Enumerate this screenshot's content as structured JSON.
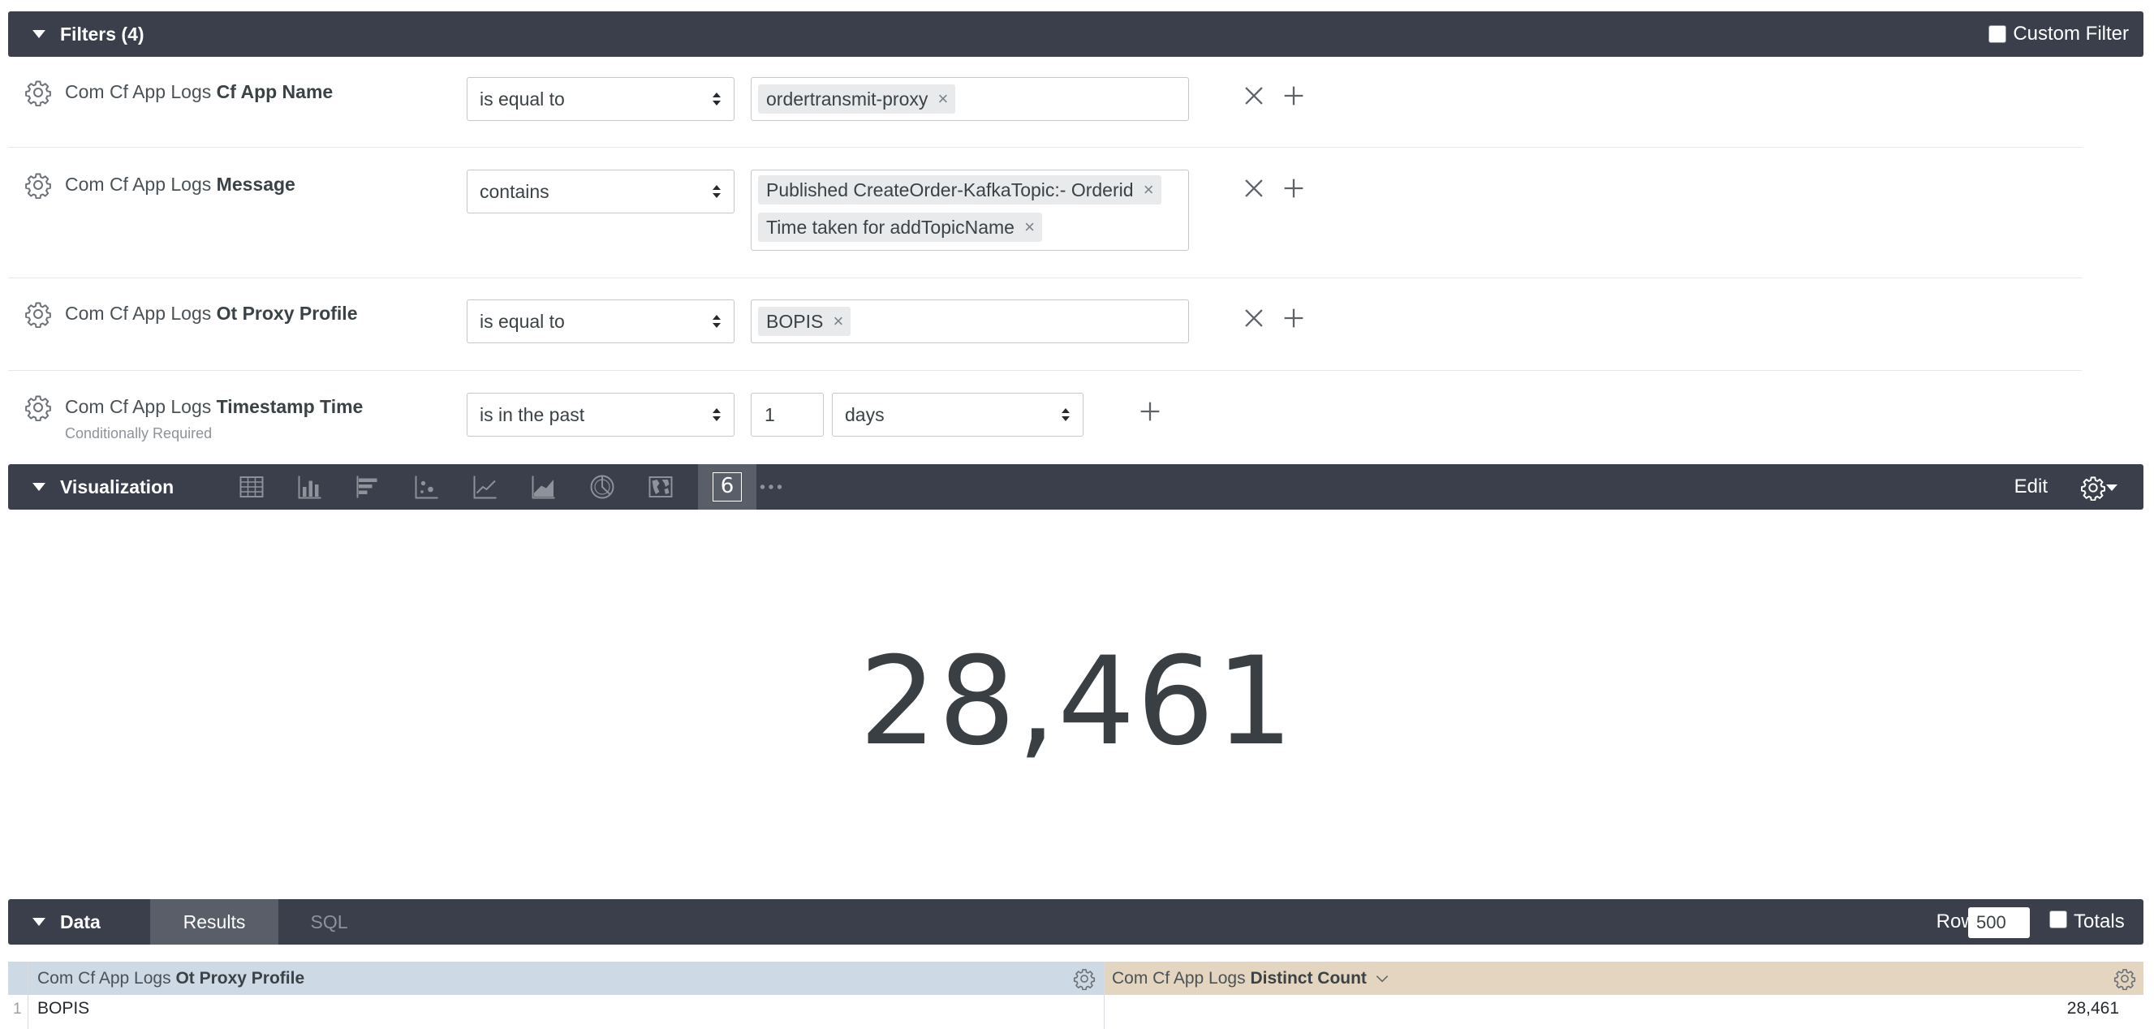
{
  "filters": {
    "title": "Filters (4)",
    "custom_filter_label": "Custom Filter",
    "rows": [
      {
        "label_prefix": "Com Cf App Logs",
        "label_field": "Cf App Name",
        "operator": "is equal to",
        "values": [
          "ordertransmit-proxy"
        ]
      },
      {
        "label_prefix": "Com Cf App Logs",
        "label_field": "Message",
        "operator": "contains",
        "values": [
          "Published CreateOrder-KafkaTopic:- Orderid",
          "Time taken for addTopicName"
        ]
      },
      {
        "label_prefix": "Com Cf App Logs",
        "label_field": "Ot Proxy Profile",
        "operator": "is equal to",
        "values": [
          "BOPIS"
        ]
      },
      {
        "label_prefix": "Com Cf App Logs",
        "label_field": "Timestamp Time",
        "sublabel": "Conditionally Required",
        "operator": "is in the past",
        "number": "1",
        "unit": "days"
      }
    ]
  },
  "visualization": {
    "title": "Visualization",
    "edit_label": "Edit",
    "active_icon_text": "6",
    "value": "28,461",
    "icons": [
      "table-icon",
      "column-chart-icon",
      "bar-chart-icon",
      "scatter-icon",
      "line-chart-icon",
      "area-chart-icon",
      "pie-chart-icon",
      "map-icon",
      "single-value-icon",
      "more-icon"
    ]
  },
  "data": {
    "title": "Data",
    "tabs": [
      "Results",
      "SQL"
    ],
    "row_limit_label": "Row Limit",
    "row_limit_value": "500",
    "totals_label": "Totals",
    "columns": [
      {
        "prefix": "Com Cf App Logs",
        "field": "Ot Proxy Profile"
      },
      {
        "prefix": "Com Cf App Logs",
        "field": "Distinct Count"
      }
    ],
    "rows": [
      {
        "index": "1",
        "cells": [
          "BOPIS",
          "28,461"
        ]
      }
    ]
  },
  "colors": {
    "bar_bg": "#3a3f4b",
    "dimension_header_bg": "#cdd9e5",
    "measure_header_bg": "#e4d5c0",
    "active_tab_bg": "#595e69"
  }
}
